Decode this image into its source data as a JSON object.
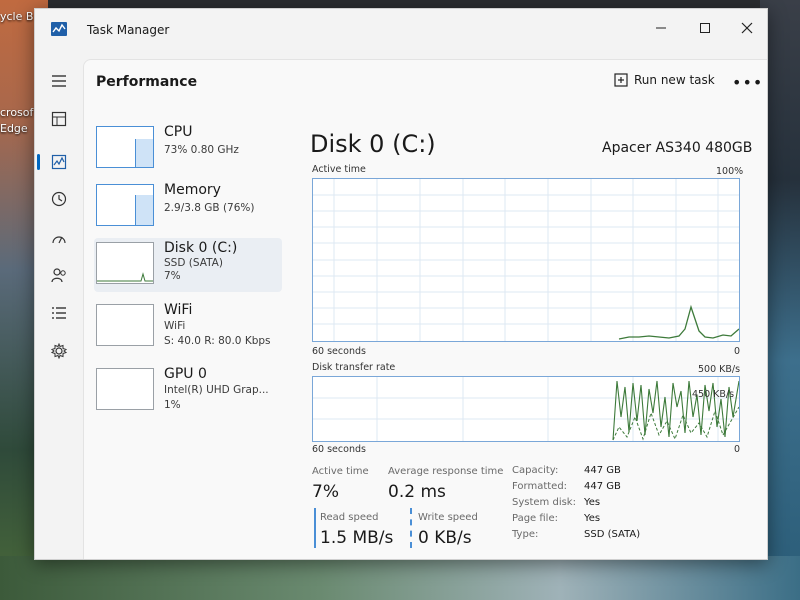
{
  "desktop": {
    "recycle_label": "ycle B",
    "edge_label_1": "crosof",
    "edge_label_2": "Edge"
  },
  "window": {
    "title": "Task Manager",
    "controls": [
      "minimize",
      "maximize",
      "close"
    ]
  },
  "nav": {
    "icons": [
      "hamburger-icon",
      "processes-icon",
      "performance-icon",
      "app-history-icon",
      "startup-apps-icon",
      "users-icon",
      "details-icon",
      "services-icon",
      "settings-icon"
    ],
    "active": "performance"
  },
  "header": {
    "title": "Performance",
    "run_new_task": "Run new task",
    "more": "•••"
  },
  "devices": [
    {
      "name": "CPU",
      "line1": "73%  0.80 GHz",
      "line2": "",
      "level": 0.7
    },
    {
      "name": "Memory",
      "line1": "2.9/3.8 GB (76%)",
      "line2": "",
      "level": 0.76
    },
    {
      "name": "Disk 0 (C:)",
      "line1": "SSD (SATA)",
      "line2": "7%",
      "level": 0.07
    },
    {
      "name": "WiFi",
      "line1": "WiFi",
      "line2": "S: 40.0  R: 80.0 Kbps",
      "level": 0.0
    },
    {
      "name": "GPU 0",
      "line1": "Intel(R) UHD Grap...",
      "line2": "1%",
      "level": 0.01
    }
  ],
  "detail": {
    "title": "Disk 0 (C:)",
    "model": "Apacer AS340 480GB",
    "active_time_graph": {
      "label": "Active time",
      "max": "100%",
      "duration": "60 seconds",
      "min": "0"
    },
    "transfer_graph": {
      "label": "Disk transfer rate",
      "max": "500 KB/s",
      "mid": "450 KB/s",
      "duration": "60 seconds",
      "min": "0"
    },
    "stats": {
      "active_time_label": "Active time",
      "active_time_value": "7%",
      "response_label": "Average response time",
      "response_value": "0.2 ms",
      "read_label": "Read speed",
      "read_value": "1.5 MB/s",
      "write_label": "Write speed",
      "write_value": "0 KB/s"
    },
    "properties": [
      {
        "label": "Capacity:",
        "value": "447 GB"
      },
      {
        "label": "Formatted:",
        "value": "447 GB"
      },
      {
        "label": "System disk:",
        "value": "Yes"
      },
      {
        "label": "Page file:",
        "value": "Yes"
      },
      {
        "label": "Type:",
        "value": "SSD (SATA)"
      }
    ]
  },
  "colors": {
    "accent": "#0067c0",
    "graph_border": "#7aa7d8",
    "graph_line": "#4a8fd6",
    "transfer_line": "#3d7a3a"
  }
}
